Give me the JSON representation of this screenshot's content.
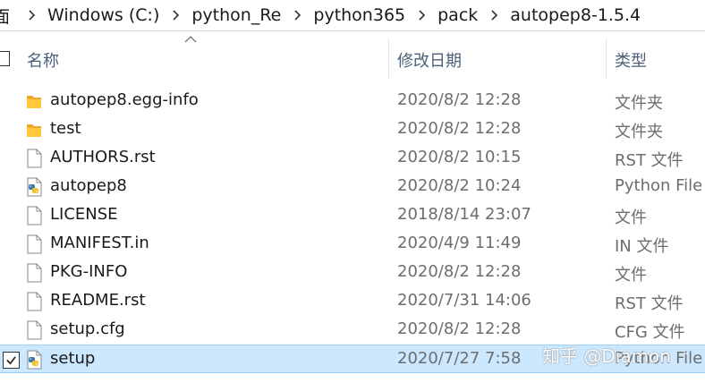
{
  "breadcrumb": {
    "stub": "面",
    "items": [
      "Windows (C:)",
      "python_Re",
      "python365",
      "pack",
      "autopep8-1.5.4"
    ]
  },
  "columns": {
    "name": "名称",
    "date": "修改日期",
    "type": "类型"
  },
  "files": [
    {
      "name": "autopep8.egg-info",
      "date": "2020/8/2 12:28",
      "type": "文件夹",
      "icon": "folder-icon"
    },
    {
      "name": "test",
      "date": "2020/8/2 12:28",
      "type": "文件夹",
      "icon": "folder-icon"
    },
    {
      "name": "AUTHORS.rst",
      "date": "2020/8/2 10:15",
      "type": "RST 文件",
      "icon": "file-icon"
    },
    {
      "name": "autopep8",
      "date": "2020/8/2 10:24",
      "type": "Python File",
      "icon": "python-file-icon"
    },
    {
      "name": "LICENSE",
      "date": "2018/8/14 23:07",
      "type": "文件",
      "icon": "file-icon"
    },
    {
      "name": "MANIFEST.in",
      "date": "2020/4/9 11:49",
      "type": "IN 文件",
      "icon": "file-icon"
    },
    {
      "name": "PKG-INFO",
      "date": "2020/8/2 12:28",
      "type": "文件",
      "icon": "file-icon"
    },
    {
      "name": "README.rst",
      "date": "2020/7/31 14:06",
      "type": "RST 文件",
      "icon": "file-icon"
    },
    {
      "name": "setup.cfg",
      "date": "2020/8/2 12:28",
      "type": "CFG 文件",
      "icon": "file-icon"
    },
    {
      "name": "setup",
      "date": "2020/7/27 7:58",
      "type": "Python File",
      "icon": "python-file-icon",
      "selected": true
    }
  ],
  "watermark": "知乎 @Diamon",
  "colors": {
    "selection_bg": "#cce8ff",
    "selection_border": "#99d1ff",
    "header_text": "#4c607a",
    "meta_text": "#6d6d6d",
    "folder": "#ffc83d"
  }
}
